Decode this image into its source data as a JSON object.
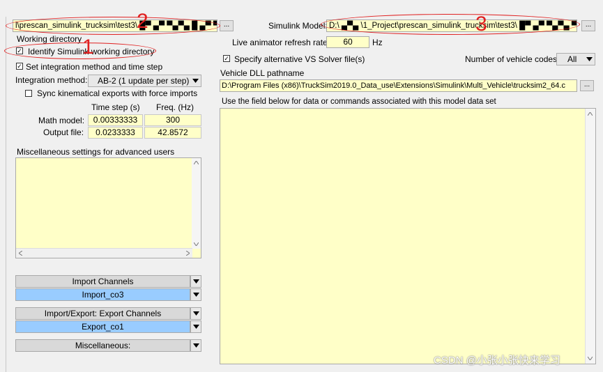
{
  "left": {
    "path_field": "l\\prescan_simulink_trucksim\\test3\\ █▀ ▄▀ ▀▄▀▄ █ ▄▀ ▀ ▄",
    "browse_label": "...",
    "working_dir_title": "Working directory",
    "identify_label": "Identify Simulink working directory",
    "set_integration_label": "Set integration method and time step",
    "integration_method_label": "Integration method:",
    "integration_method_value": "AB-2 (1 update per step)",
    "sync_label": "Sync kinematical exports with force imports",
    "col_timestep": "Time step (s)",
    "col_freq": "Freq. (Hz)",
    "row_math_label": "Math model:",
    "row_math_timestep": "0.00333333",
    "row_math_freq": "300",
    "row_output_label": "Output file:",
    "row_output_timestep": "0.0233333",
    "row_output_freq": "42.8572",
    "misc_title": "Miscellaneous settings for advanced users",
    "import_channels_label": "Import Channels",
    "import_channels_value": "Import_co3",
    "export_channels_label": "Import/Export: Export Channels",
    "export_channels_value": "Export_co1",
    "miscellaneous_label": "Miscellaneous:"
  },
  "right": {
    "simulink_model_label": "Simulink Model:",
    "simulink_model_value": "D:\\ ▄▀▄ \\1_Project\\prescan_simulink_trucksim\\test3\\ █▀ ▄▀ ▀▄▀▄ ▀ ▄al",
    "browse_label": "...",
    "refresh_rate_label": "Live animator refresh rate:",
    "refresh_rate_value": "60",
    "refresh_rate_unit": "Hz",
    "vs_solver_label": "Specify alternative VS Solver file(s)",
    "num_vehicle_codes_label": "Number of vehicle codes:",
    "num_vehicle_codes_value": "All",
    "dll_title": "Vehicle DLL pathname",
    "dll_value": "D:\\Program Files (x86)\\TruckSim2019.0_Data_use\\Extensions\\Simulink\\Multi_Vehicle\\trucksim2_64.c",
    "notes_title": "Use the field below  for data or commands associated with this model data set"
  },
  "annotations": {
    "num1": "1",
    "num2": "2",
    "num3": "3",
    "color": "#e02020"
  },
  "watermark": "CSDN @小张小张快来学习"
}
